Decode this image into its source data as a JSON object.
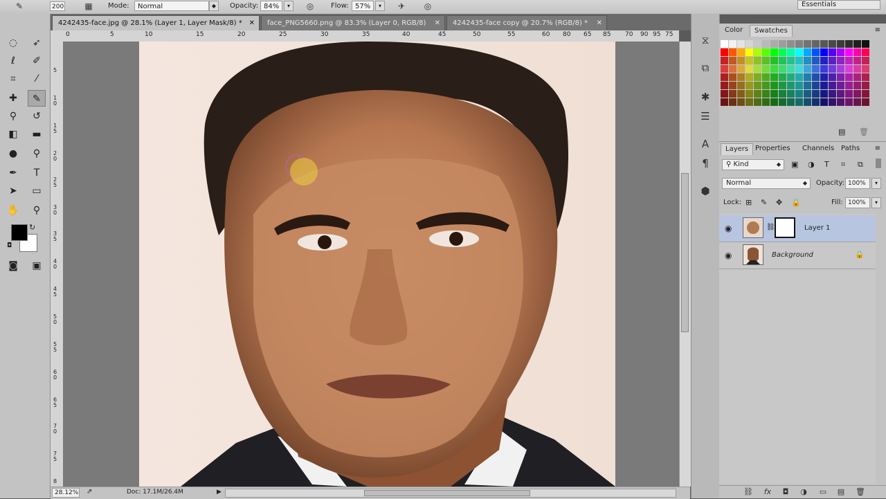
{
  "options_bar": {
    "brush_size": "200",
    "mode_label": "Mode:",
    "mode_value": "Normal",
    "opacity_label": "Opacity:",
    "opacity_value": "84%",
    "flow_label": "Flow:",
    "flow_value": "57%",
    "workspace": "Essentials"
  },
  "tabs": [
    {
      "label": "4242435-face.jpg @ 28.1% (Layer 1, Layer Mask/8) *",
      "active": true
    },
    {
      "label": "face_PNG5660.png @ 83.3% (Layer 0, RGB/8)",
      "active": false
    },
    {
      "label": "4242435-face copy @ 20.7% (RGB/8) *",
      "active": false
    }
  ],
  "ruler_top": [
    "0",
    "5",
    "10",
    "15",
    "20",
    "25",
    "30",
    "35",
    "40",
    "45",
    "50",
    "55",
    "60",
    "65",
    "70",
    "75",
    "80",
    "85",
    "90",
    "95"
  ],
  "ruler_left": [
    "5",
    "1 0",
    "1 5",
    "2 0",
    "2 5",
    "3 0",
    "3 5",
    "4 0",
    "4 5",
    "5 0",
    "5 5",
    "6 0",
    "6 5",
    "7 0",
    "7 5",
    "8"
  ],
  "status": {
    "zoom": "28.12%",
    "doc": "Doc: 17.1M/26.4M"
  },
  "color_panel": {
    "tabs": [
      "Color",
      "Swatches"
    ],
    "active_tab": "Swatches"
  },
  "layers_panel": {
    "tabs": [
      "Layers",
      "Properties",
      "Channels",
      "Paths"
    ],
    "filter_kind": "Kind",
    "blend_mode": "Normal",
    "opacity_label": "Opacity:",
    "opacity_value": "100%",
    "lock_label": "Lock:",
    "fill_label": "Fill:",
    "fill_value": "100%",
    "layers": [
      {
        "name": "Layer 1",
        "selected": true
      },
      {
        "name": "Background",
        "selected": false
      }
    ]
  },
  "colors": {
    "foreground": "#000000",
    "background": "#ffffff",
    "selection": "#b7c5e0"
  }
}
